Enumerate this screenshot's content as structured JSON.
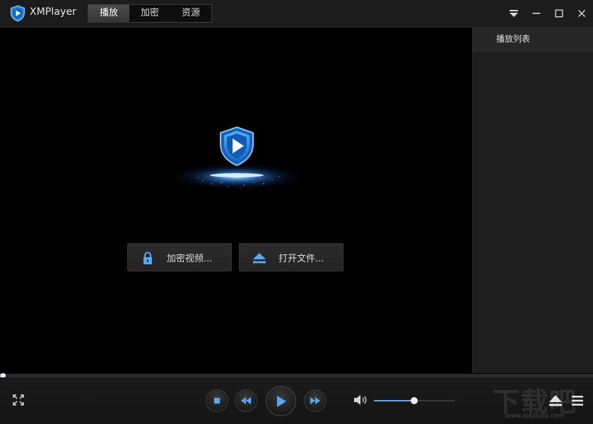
{
  "app": {
    "title": "XMPlayer"
  },
  "tabs": [
    {
      "label": "播放",
      "active": true
    },
    {
      "label": "加密",
      "active": false
    },
    {
      "label": "资源",
      "active": false
    }
  ],
  "window_controls": {
    "icons": [
      "dropdown-menu-icon",
      "minimize-icon",
      "maximize-icon",
      "close-icon"
    ]
  },
  "main": {
    "encrypt_button": {
      "label": "加密视频...",
      "icon": "lock-icon"
    },
    "open_button": {
      "label": "打开文件...",
      "icon": "eject-icon"
    }
  },
  "playlist": {
    "header": "播放列表"
  },
  "player": {
    "progress": 0.005,
    "volume": 0.5,
    "buttons": [
      "fullscreen-icon",
      "stop-icon",
      "rewind-icon",
      "play-icon",
      "fast-forward-icon",
      "volume-icon",
      "eject-icon",
      "menu-icon"
    ]
  },
  "watermark": {
    "text": "下载吧",
    "url": "www.xiazaiba.com"
  },
  "colors": {
    "accent": "#6aa6e8",
    "shield": "#2b8ee6",
    "panel": "#1e1e1e"
  }
}
